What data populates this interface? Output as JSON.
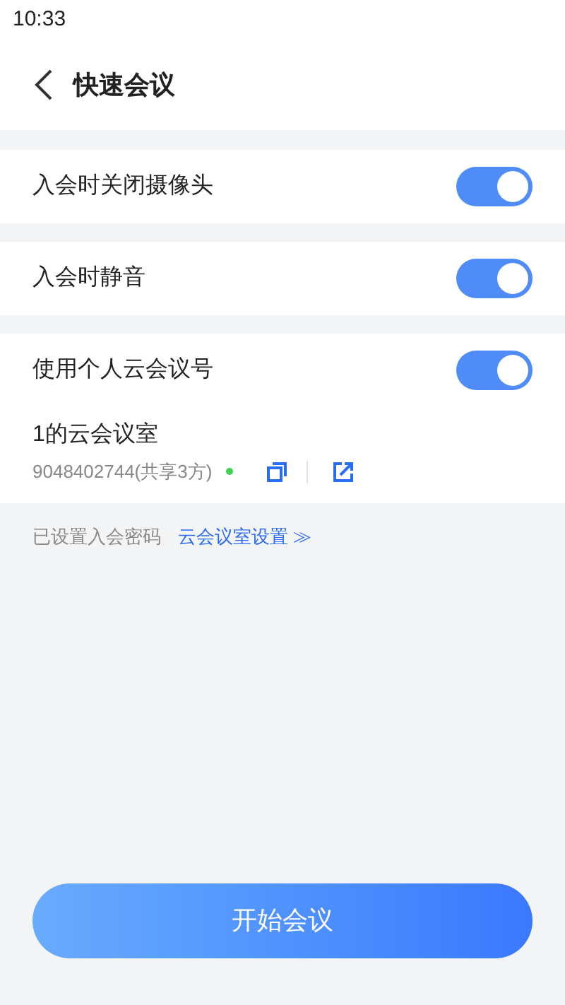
{
  "status_bar": {
    "time": "10:33"
  },
  "header": {
    "title": "快速会议"
  },
  "settings": [
    {
      "label": "入会时关闭摄像头",
      "on": true
    },
    {
      "label": "入会时静音",
      "on": true
    },
    {
      "label": "使用个人云会议号",
      "on": true
    }
  ],
  "room": {
    "name": "1的云会议室",
    "number": "9048402744(共享3方)"
  },
  "password_note": "已设置入会密码",
  "room_settings_link": "云会议室设置 ≫",
  "start_button": "开始会议"
}
